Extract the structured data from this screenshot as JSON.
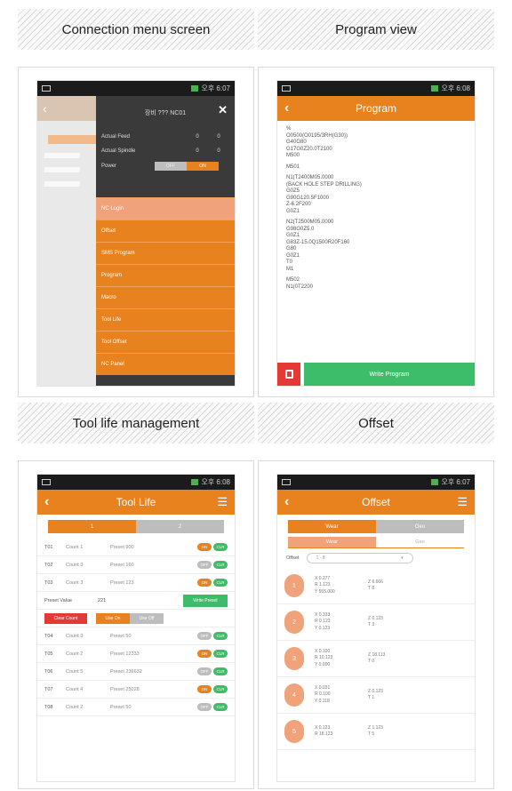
{
  "status": {
    "time": "오후 6:07",
    "time_program": "오후 6:08",
    "time_tool": "오후 6:08",
    "time_offset": "오후 6:07"
  },
  "captions": {
    "connection": "Connection menu screen",
    "program": "Program view",
    "tool_life": "Tool life management",
    "offset": "Offset"
  },
  "connection": {
    "machine_name": "장비 ??? NC01",
    "rows": [
      {
        "label": "Actual Feed",
        "v1": "0",
        "v2": "0"
      },
      {
        "label": "Actual Spindle",
        "v1": "0",
        "v2": "0"
      }
    ],
    "power_label": "Power",
    "power_off": "OFF",
    "power_on": "ON",
    "menu": [
      "NC Login",
      "Offset",
      "SMS Program",
      "Program",
      "Macro",
      "Tool Life",
      "Tool Offset",
      "NC Panel"
    ]
  },
  "program": {
    "title": "Program",
    "lines": [
      "%\nO0500(O0195/3RH(G30))\nG40G80\nG17G0Z20.0T2100\nM500",
      "M501",
      "N1(T2400M05.0000\n(BACK HOLE STEP DRILLING)\nG0Z5\nG90G120.5F1000\nZ-6.2F200\nG0Z1",
      "N2(T2500M05.0000\nG98G0Z5.0\nG0Z1\nG83Z-15.0Q1500R20F160\nG80\nG0Z1\nT0\nM1",
      "M502\nN1(0T2200"
    ],
    "write_label": "Write Program"
  },
  "tool_life": {
    "title": "Tool Life",
    "tabs": [
      "1",
      "2"
    ],
    "rows_top": [
      {
        "t": "T01",
        "count": "Count 1",
        "preset": "Preset 900",
        "a": "ON",
        "b": "CLR",
        "a_state": "on"
      },
      {
        "t": "T02",
        "count": "Count 3",
        "preset": "Preset 160",
        "a": "OFF",
        "b": "CLR",
        "a_state": "off"
      },
      {
        "t": "T03",
        "count": "Count 3",
        "preset": "Preset 123",
        "a": "ON",
        "b": "CLR",
        "a_state": "on"
      }
    ],
    "preset_value_label": "Preset Value",
    "preset_value": "221",
    "write_preset_label": "Write Preset",
    "clear_count_label": "Clear Count",
    "use_on_label": "Use On",
    "use_off_label": "Use Off",
    "rows_bottom": [
      {
        "t": "T04",
        "count": "Count 3",
        "preset": "Preset 50",
        "a": "OFF",
        "b": "CLR",
        "a_state": "off"
      },
      {
        "t": "T05",
        "count": "Count 2",
        "preset": "Preset 12333",
        "a": "ON",
        "b": "CLR",
        "a_state": "on"
      },
      {
        "t": "T06",
        "count": "Count 5",
        "preset": "Preset 236632",
        "a": "OFF",
        "b": "CLR",
        "a_state": "off"
      },
      {
        "t": "T07",
        "count": "Count 4",
        "preset": "Preset 25028",
        "a": "ON",
        "b": "CLR",
        "a_state": "on"
      },
      {
        "t": "T08",
        "count": "Count 2",
        "preset": "Preset 50",
        "a": "OFF",
        "b": "CLR",
        "a_state": "off"
      }
    ]
  },
  "offset": {
    "title": "Offset",
    "tabs": [
      "Wear",
      "Geo"
    ],
    "sub_tabs": [
      "Wear",
      "Geo"
    ],
    "select_label": "Offset",
    "select_value": "1 - 8",
    "items": [
      {
        "n": "1",
        "x": "X 0.277",
        "r": "R 1.123",
        "y": "Y 555.000",
        "z": "Z 6.666",
        "tt": "T 8"
      },
      {
        "n": "2",
        "x": "X 0.333",
        "r": "R 0.123",
        "y": "Y 0.123",
        "z": "Z 0.123",
        "tt": "T 3"
      },
      {
        "n": "3",
        "x": "X 0.100",
        "r": "R 10.123",
        "y": "Y 0.000",
        "z": "Z 18.113",
        "tt": "T 0"
      },
      {
        "n": "4",
        "x": "X 0.031",
        "r": "R 0.100",
        "y": "Y 0.118",
        "z": "Z 0.123",
        "tt": "T 1"
      },
      {
        "n": "5",
        "x": "X 0.123",
        "r": "R 18.123",
        "y": "",
        "z": "Z 1.123",
        "tt": "T 5"
      }
    ]
  }
}
